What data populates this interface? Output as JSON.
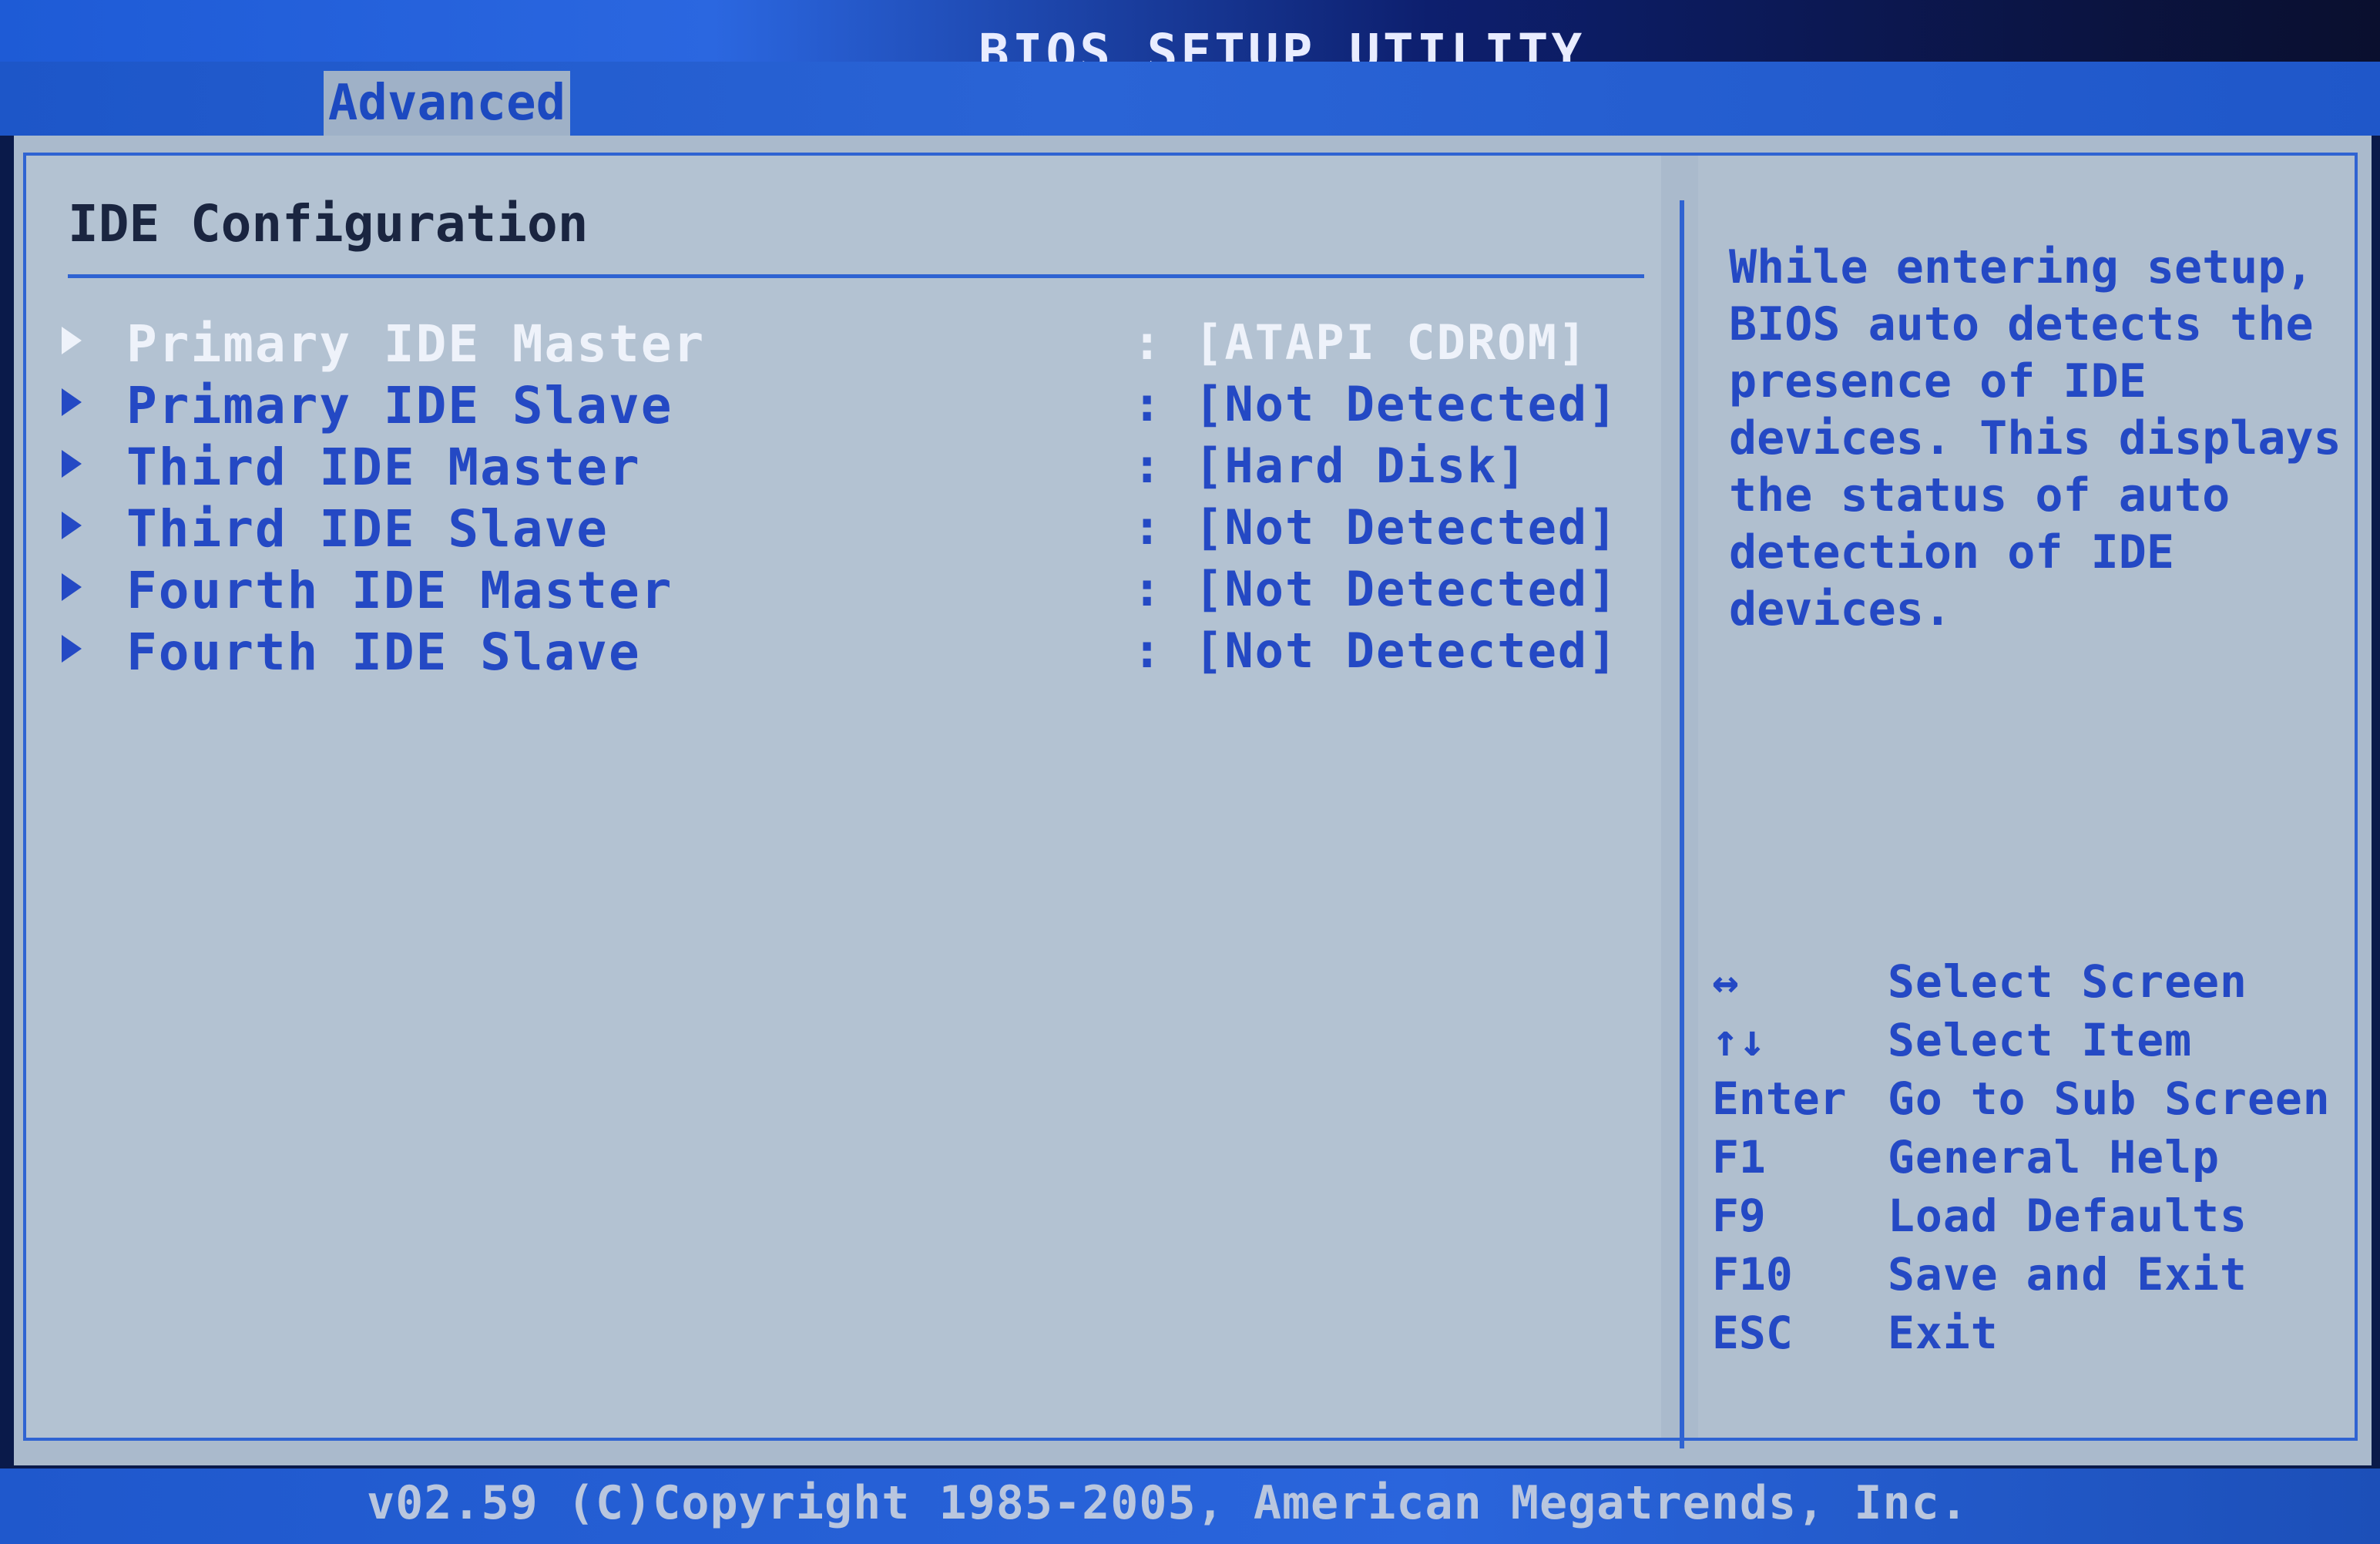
{
  "title": "BIOS SETUP UTILITY",
  "tabs": [
    {
      "label": "Advanced",
      "active": true
    }
  ],
  "section_title": "IDE Configuration",
  "menu_items": [
    {
      "label": "Primary IDE Master",
      "value": "[ATAPI CDROM]",
      "selected": true
    },
    {
      "label": "Primary IDE Slave",
      "value": "[Not Detected]",
      "selected": false
    },
    {
      "label": "Third IDE Master",
      "value": "[Hard Disk]",
      "selected": false
    },
    {
      "label": "Third IDE Slave",
      "value": "[Not Detected]",
      "selected": false
    },
    {
      "label": "Fourth IDE Master",
      "value": "[Not Detected]",
      "selected": false
    },
    {
      "label": "Fourth IDE Slave",
      "value": "[Not Detected]",
      "selected": false
    }
  ],
  "separator": ":",
  "help_lines": [
    "While entering setup,",
    "BIOS auto detects the",
    "presence of IDE",
    "devices. This displays",
    "the status of auto",
    "detection of IDE",
    "devices."
  ],
  "keys": [
    {
      "key": "↔",
      "desc": "Select Screen"
    },
    {
      "key": "↑↓",
      "desc": "Select Item"
    },
    {
      "key": "Enter",
      "desc": "Go to Sub Screen"
    },
    {
      "key": "F1",
      "desc": "General Help"
    },
    {
      "key": "F9",
      "desc": "Load Defaults"
    },
    {
      "key": "F10",
      "desc": "Save and Exit"
    },
    {
      "key": "ESC",
      "desc": "Exit"
    }
  ],
  "footer": "v02.59 (C)Copyright 1985-2005, American Megatrends, Inc.",
  "colors": {
    "item_text": "#2449c4",
    "selected_text": "#eef2fa",
    "panel_bg": "#b3c2d2",
    "title_bar": "#1e5bd6"
  }
}
